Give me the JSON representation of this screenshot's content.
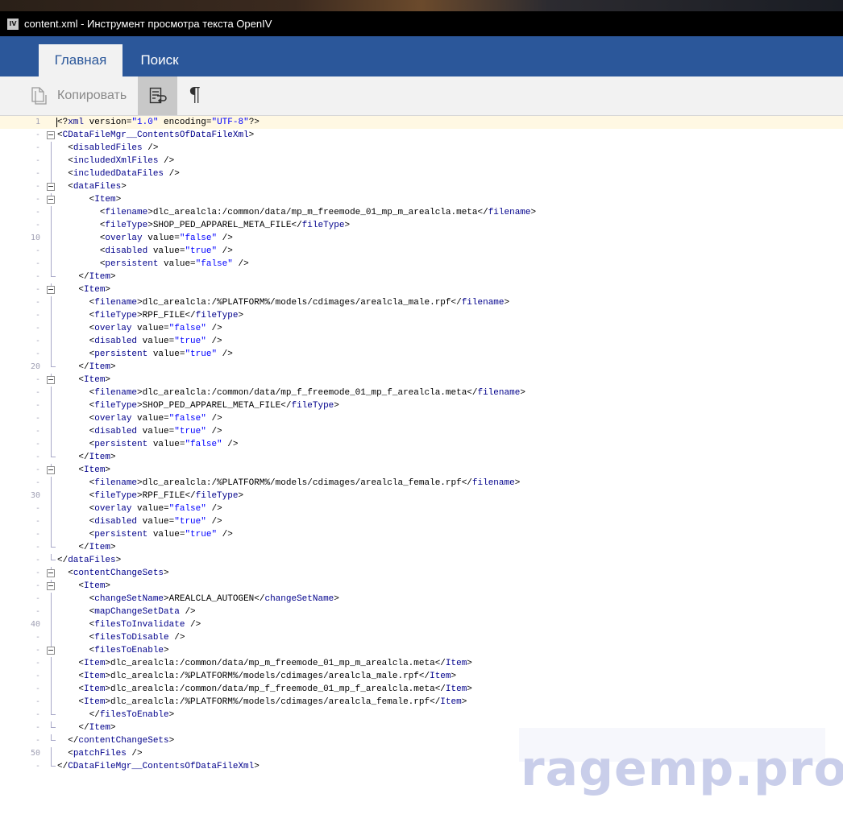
{
  "window": {
    "app_icon_text": "IV",
    "title": "content.xml - Инструмент просмотра текста OpenIV"
  },
  "ribbon": {
    "tabs": [
      "Главная",
      "Поиск"
    ],
    "active_tab": "Главная",
    "buttons": {
      "copy_label": "Копировать",
      "wrap_icon": "word-wrap-icon",
      "pilcrow_glyph": "¶"
    }
  },
  "editor": {
    "current_line": 1,
    "lines": [
      {
        "n": "1",
        "g": "",
        "indent": "",
        "parts": [
          [
            "p",
            "<?"
          ],
          [
            "t",
            "xml"
          ],
          [
            "p",
            " version="
          ],
          [
            "v",
            "\"1.0\""
          ],
          [
            "p",
            " encoding="
          ],
          [
            "v",
            "\"UTF-8\""
          ],
          [
            "p",
            "?>"
          ]
        ]
      },
      {
        "n": "-",
        "g": "fold",
        "indent": "",
        "parts": [
          [
            "p",
            "<"
          ],
          [
            "t",
            "CDataFileMgr__ContentsOfDataFileXml"
          ],
          [
            "p",
            ">"
          ]
        ]
      },
      {
        "n": "-",
        "g": "line",
        "indent": "  ",
        "parts": [
          [
            "p",
            "<"
          ],
          [
            "t",
            "disabledFiles"
          ],
          [
            "p",
            " />"
          ]
        ]
      },
      {
        "n": "-",
        "g": "line",
        "indent": "  ",
        "parts": [
          [
            "p",
            "<"
          ],
          [
            "t",
            "includedXmlFiles"
          ],
          [
            "p",
            " />"
          ]
        ]
      },
      {
        "n": "-",
        "g": "line",
        "indent": "  ",
        "parts": [
          [
            "p",
            "<"
          ],
          [
            "t",
            "includedDataFiles"
          ],
          [
            "p",
            " />"
          ]
        ]
      },
      {
        "n": "-",
        "g": "fold",
        "indent": "  ",
        "parts": [
          [
            "p",
            "<"
          ],
          [
            "t",
            "dataFiles"
          ],
          [
            "p",
            ">"
          ]
        ]
      },
      {
        "n": "-",
        "g": "fold",
        "indent": "      ",
        "parts": [
          [
            "p",
            "<"
          ],
          [
            "t",
            "Item"
          ],
          [
            "p",
            ">"
          ]
        ]
      },
      {
        "n": "-",
        "g": "line",
        "indent": "        ",
        "parts": [
          [
            "p",
            "<"
          ],
          [
            "t",
            "filename"
          ],
          [
            "p",
            ">dlc_arealcla:/common/data/mp_m_freemode_01_mp_m_arealcla.meta</"
          ],
          [
            "t",
            "filename"
          ],
          [
            "p",
            ">"
          ]
        ]
      },
      {
        "n": "-",
        "g": "line",
        "indent": "        ",
        "parts": [
          [
            "p",
            "<"
          ],
          [
            "t",
            "fileType"
          ],
          [
            "p",
            ">SHOP_PED_APPAREL_META_FILE</"
          ],
          [
            "t",
            "fileType"
          ],
          [
            "p",
            ">"
          ]
        ]
      },
      {
        "n": "10",
        "g": "line",
        "indent": "        ",
        "parts": [
          [
            "p",
            "<"
          ],
          [
            "t",
            "overlay"
          ],
          [
            "p",
            " value="
          ],
          [
            "v",
            "\"false\""
          ],
          [
            "p",
            " />"
          ]
        ]
      },
      {
        "n": "-",
        "g": "line",
        "indent": "        ",
        "parts": [
          [
            "p",
            "<"
          ],
          [
            "t",
            "disabled"
          ],
          [
            "p",
            " value="
          ],
          [
            "v",
            "\"true\""
          ],
          [
            "p",
            " />"
          ]
        ]
      },
      {
        "n": "-",
        "g": "line",
        "indent": "        ",
        "parts": [
          [
            "p",
            "<"
          ],
          [
            "t",
            "persistent"
          ],
          [
            "p",
            " value="
          ],
          [
            "v",
            "\"false\""
          ],
          [
            "p",
            " />"
          ]
        ]
      },
      {
        "n": "-",
        "g": "end",
        "indent": "    ",
        "parts": [
          [
            "p",
            "</"
          ],
          [
            "t",
            "Item"
          ],
          [
            "p",
            ">"
          ]
        ]
      },
      {
        "n": "-",
        "g": "fold",
        "indent": "    ",
        "parts": [
          [
            "p",
            "<"
          ],
          [
            "t",
            "Item"
          ],
          [
            "p",
            ">"
          ]
        ]
      },
      {
        "n": "-",
        "g": "line",
        "indent": "      ",
        "parts": [
          [
            "p",
            "<"
          ],
          [
            "t",
            "filename"
          ],
          [
            "p",
            ">dlc_arealcla:/%PLATFORM%/models/cdimages/arealcla_male.rpf</"
          ],
          [
            "t",
            "filename"
          ],
          [
            "p",
            ">"
          ]
        ]
      },
      {
        "n": "-",
        "g": "line",
        "indent": "      ",
        "parts": [
          [
            "p",
            "<"
          ],
          [
            "t",
            "fileType"
          ],
          [
            "p",
            ">RPF_FILE</"
          ],
          [
            "t",
            "fileType"
          ],
          [
            "p",
            ">"
          ]
        ]
      },
      {
        "n": "-",
        "g": "line",
        "indent": "      ",
        "parts": [
          [
            "p",
            "<"
          ],
          [
            "t",
            "overlay"
          ],
          [
            "p",
            " value="
          ],
          [
            "v",
            "\"false\""
          ],
          [
            "p",
            " />"
          ]
        ]
      },
      {
        "n": "-",
        "g": "line",
        "indent": "      ",
        "parts": [
          [
            "p",
            "<"
          ],
          [
            "t",
            "disabled"
          ],
          [
            "p",
            " value="
          ],
          [
            "v",
            "\"true\""
          ],
          [
            "p",
            " />"
          ]
        ]
      },
      {
        "n": "-",
        "g": "line",
        "indent": "      ",
        "parts": [
          [
            "p",
            "<"
          ],
          [
            "t",
            "persistent"
          ],
          [
            "p",
            " value="
          ],
          [
            "v",
            "\"true\""
          ],
          [
            "p",
            " />"
          ]
        ]
      },
      {
        "n": "20",
        "g": "end",
        "indent": "    ",
        "parts": [
          [
            "p",
            "</"
          ],
          [
            "t",
            "Item"
          ],
          [
            "p",
            ">"
          ]
        ]
      },
      {
        "n": "-",
        "g": "fold",
        "indent": "    ",
        "parts": [
          [
            "p",
            "<"
          ],
          [
            "t",
            "Item"
          ],
          [
            "p",
            ">"
          ]
        ]
      },
      {
        "n": "-",
        "g": "line",
        "indent": "      ",
        "parts": [
          [
            "p",
            "<"
          ],
          [
            "t",
            "filename"
          ],
          [
            "p",
            ">dlc_arealcla:/common/data/mp_f_freemode_01_mp_f_arealcla.meta</"
          ],
          [
            "t",
            "filename"
          ],
          [
            "p",
            ">"
          ]
        ]
      },
      {
        "n": "-",
        "g": "line",
        "indent": "      ",
        "parts": [
          [
            "p",
            "<"
          ],
          [
            "t",
            "fileType"
          ],
          [
            "p",
            ">SHOP_PED_APPAREL_META_FILE</"
          ],
          [
            "t",
            "fileType"
          ],
          [
            "p",
            ">"
          ]
        ]
      },
      {
        "n": "-",
        "g": "line",
        "indent": "      ",
        "parts": [
          [
            "p",
            "<"
          ],
          [
            "t",
            "overlay"
          ],
          [
            "p",
            " value="
          ],
          [
            "v",
            "\"false\""
          ],
          [
            "p",
            " />"
          ]
        ]
      },
      {
        "n": "-",
        "g": "line",
        "indent": "      ",
        "parts": [
          [
            "p",
            "<"
          ],
          [
            "t",
            "disabled"
          ],
          [
            "p",
            " value="
          ],
          [
            "v",
            "\"true\""
          ],
          [
            "p",
            " />"
          ]
        ]
      },
      {
        "n": "-",
        "g": "line",
        "indent": "      ",
        "parts": [
          [
            "p",
            "<"
          ],
          [
            "t",
            "persistent"
          ],
          [
            "p",
            " value="
          ],
          [
            "v",
            "\"false\""
          ],
          [
            "p",
            " />"
          ]
        ]
      },
      {
        "n": "-",
        "g": "end",
        "indent": "    ",
        "parts": [
          [
            "p",
            "</"
          ],
          [
            "t",
            "Item"
          ],
          [
            "p",
            ">"
          ]
        ]
      },
      {
        "n": "-",
        "g": "fold",
        "indent": "    ",
        "parts": [
          [
            "p",
            "<"
          ],
          [
            "t",
            "Item"
          ],
          [
            "p",
            ">"
          ]
        ]
      },
      {
        "n": "-",
        "g": "line",
        "indent": "      ",
        "parts": [
          [
            "p",
            "<"
          ],
          [
            "t",
            "filename"
          ],
          [
            "p",
            ">dlc_arealcla:/%PLATFORM%/models/cdimages/arealcla_female.rpf</"
          ],
          [
            "t",
            "filename"
          ],
          [
            "p",
            ">"
          ]
        ]
      },
      {
        "n": "30",
        "g": "line",
        "indent": "      ",
        "parts": [
          [
            "p",
            "<"
          ],
          [
            "t",
            "fileType"
          ],
          [
            "p",
            ">RPF_FILE</"
          ],
          [
            "t",
            "fileType"
          ],
          [
            "p",
            ">"
          ]
        ]
      },
      {
        "n": "-",
        "g": "line",
        "indent": "      ",
        "parts": [
          [
            "p",
            "<"
          ],
          [
            "t",
            "overlay"
          ],
          [
            "p",
            " value="
          ],
          [
            "v",
            "\"false\""
          ],
          [
            "p",
            " />"
          ]
        ]
      },
      {
        "n": "-",
        "g": "line",
        "indent": "      ",
        "parts": [
          [
            "p",
            "<"
          ],
          [
            "t",
            "disabled"
          ],
          [
            "p",
            " value="
          ],
          [
            "v",
            "\"true\""
          ],
          [
            "p",
            " />"
          ]
        ]
      },
      {
        "n": "-",
        "g": "line",
        "indent": "      ",
        "parts": [
          [
            "p",
            "<"
          ],
          [
            "t",
            "persistent"
          ],
          [
            "p",
            " value="
          ],
          [
            "v",
            "\"true\""
          ],
          [
            "p",
            " />"
          ]
        ]
      },
      {
        "n": "-",
        "g": "end",
        "indent": "    ",
        "parts": [
          [
            "p",
            "</"
          ],
          [
            "t",
            "Item"
          ],
          [
            "p",
            ">"
          ]
        ]
      },
      {
        "n": "-",
        "g": "end",
        "indent": "",
        "parts": [
          [
            "p",
            "</"
          ],
          [
            "t",
            "dataFiles"
          ],
          [
            "p",
            ">"
          ]
        ]
      },
      {
        "n": "-",
        "g": "fold",
        "indent": "  ",
        "parts": [
          [
            "p",
            "<"
          ],
          [
            "t",
            "contentChangeSets"
          ],
          [
            "p",
            ">"
          ]
        ]
      },
      {
        "n": "-",
        "g": "fold",
        "indent": "    ",
        "parts": [
          [
            "p",
            "<"
          ],
          [
            "t",
            "Item"
          ],
          [
            "p",
            ">"
          ]
        ]
      },
      {
        "n": "-",
        "g": "line",
        "indent": "      ",
        "parts": [
          [
            "p",
            "<"
          ],
          [
            "t",
            "changeSetName"
          ],
          [
            "p",
            ">AREALCLA_AUTOGEN</"
          ],
          [
            "t",
            "changeSetName"
          ],
          [
            "p",
            ">"
          ]
        ]
      },
      {
        "n": "-",
        "g": "line",
        "indent": "      ",
        "parts": [
          [
            "p",
            "<"
          ],
          [
            "t",
            "mapChangeSetData"
          ],
          [
            "p",
            " />"
          ]
        ]
      },
      {
        "n": "40",
        "g": "line",
        "indent": "      ",
        "parts": [
          [
            "p",
            "<"
          ],
          [
            "t",
            "filesToInvalidate"
          ],
          [
            "p",
            " />"
          ]
        ]
      },
      {
        "n": "-",
        "g": "line",
        "indent": "      ",
        "parts": [
          [
            "p",
            "<"
          ],
          [
            "t",
            "filesToDisable"
          ],
          [
            "p",
            " />"
          ]
        ]
      },
      {
        "n": "-",
        "g": "fold",
        "indent": "      ",
        "parts": [
          [
            "p",
            "<"
          ],
          [
            "t",
            "filesToEnable"
          ],
          [
            "p",
            ">"
          ]
        ]
      },
      {
        "n": "-",
        "g": "line",
        "indent": "    ",
        "parts": [
          [
            "p",
            "<"
          ],
          [
            "t",
            "Item"
          ],
          [
            "p",
            ">dlc_arealcla:/common/data/mp_m_freemode_01_mp_m_arealcla.meta</"
          ],
          [
            "t",
            "Item"
          ],
          [
            "p",
            ">"
          ]
        ]
      },
      {
        "n": "-",
        "g": "line",
        "indent": "    ",
        "parts": [
          [
            "p",
            "<"
          ],
          [
            "t",
            "Item"
          ],
          [
            "p",
            ">dlc_arealcla:/%PLATFORM%/models/cdimages/arealcla_male.rpf</"
          ],
          [
            "t",
            "Item"
          ],
          [
            "p",
            ">"
          ]
        ]
      },
      {
        "n": "-",
        "g": "line",
        "indent": "    ",
        "parts": [
          [
            "p",
            "<"
          ],
          [
            "t",
            "Item"
          ],
          [
            "p",
            ">dlc_arealcla:/common/data/mp_f_freemode_01_mp_f_arealcla.meta</"
          ],
          [
            "t",
            "Item"
          ],
          [
            "p",
            ">"
          ]
        ]
      },
      {
        "n": "-",
        "g": "line",
        "indent": "    ",
        "parts": [
          [
            "p",
            "<"
          ],
          [
            "t",
            "Item"
          ],
          [
            "p",
            ">dlc_arealcla:/%PLATFORM%/models/cdimages/arealcla_female.rpf</"
          ],
          [
            "t",
            "Item"
          ],
          [
            "p",
            ">"
          ]
        ]
      },
      {
        "n": "-",
        "g": "end",
        "indent": "      ",
        "parts": [
          [
            "p",
            "</"
          ],
          [
            "t",
            "filesToEnable"
          ],
          [
            "p",
            ">"
          ]
        ]
      },
      {
        "n": "-",
        "g": "end",
        "indent": "    ",
        "parts": [
          [
            "p",
            "</"
          ],
          [
            "t",
            "Item"
          ],
          [
            "p",
            ">"
          ]
        ]
      },
      {
        "n": "-",
        "g": "end",
        "indent": "  ",
        "parts": [
          [
            "p",
            "</"
          ],
          [
            "t",
            "contentChangeSets"
          ],
          [
            "p",
            ">"
          ]
        ]
      },
      {
        "n": "50",
        "g": "line",
        "indent": "  ",
        "parts": [
          [
            "p",
            "<"
          ],
          [
            "t",
            "patchFiles"
          ],
          [
            "p",
            " />"
          ]
        ]
      },
      {
        "n": "-",
        "g": "end",
        "indent": "",
        "parts": [
          [
            "p",
            "</"
          ],
          [
            "t",
            "CDataFileMgr__ContentsOfDataFileXml"
          ],
          [
            "p",
            ">"
          ]
        ]
      }
    ]
  },
  "watermark": "ragemp.pro",
  "colors": {
    "ribbon_blue": "#2b579a",
    "tag": "#00008b",
    "value": "#0000ff",
    "line_number": "#a0a0b4"
  }
}
